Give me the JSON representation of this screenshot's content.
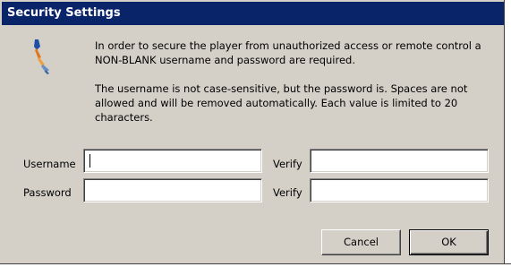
{
  "window": {
    "title": "Security Settings"
  },
  "icon": {
    "name": "security-key-icon"
  },
  "message": {
    "paragraph1": "In order to secure the player from unauthorized access or remote control a NON-BLANK username and password are required.",
    "paragraph2": "The username is not case-sensitive, but the password is.  Spaces are not allowed and will be removed automatically.  Each value is limited to 20 characters."
  },
  "form": {
    "username_label": "Username",
    "username_value": "",
    "username_verify_label": "Verify",
    "username_verify_value": "",
    "password_label": "Password",
    "password_value": "",
    "password_verify_label": "Verify",
    "password_verify_value": ""
  },
  "buttons": {
    "cancel": "Cancel",
    "ok": "OK"
  },
  "colors": {
    "titlebar": "#0a246a",
    "dialog_face": "#d4d0c8"
  }
}
